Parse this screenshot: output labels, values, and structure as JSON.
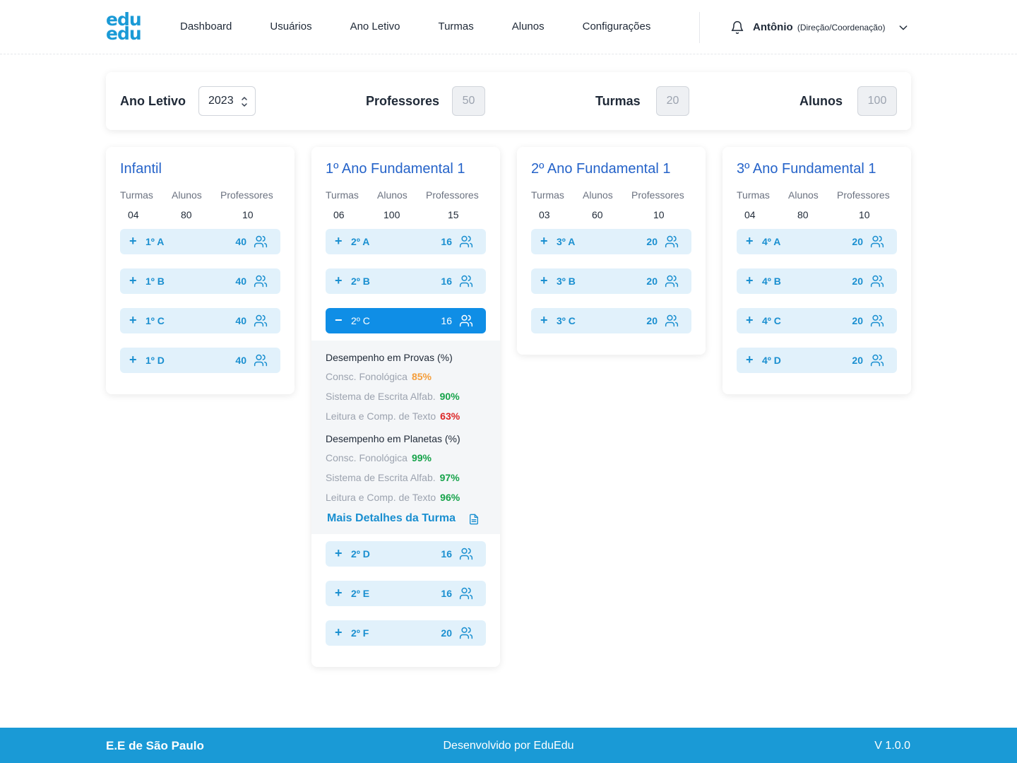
{
  "header": {
    "logo_top": "edu",
    "logo_bottom": "edu",
    "nav": [
      "Dashboard",
      "Usuários",
      "Ano Letivo",
      "Turmas",
      "Alunos",
      "Configurações"
    ],
    "user_name": "Antônio",
    "user_role": "(Direção/Coordenação)"
  },
  "summary": {
    "ano_label": "Ano Letivo",
    "ano_value": "2023",
    "professores_label": "Professores",
    "professores_value": "50",
    "turmas_label": "Turmas",
    "turmas_value": "20",
    "alunos_label": "Alunos",
    "alunos_value": "100"
  },
  "stat_labels": {
    "turmas": "Turmas",
    "alunos": "Alunos",
    "professores": "Professores"
  },
  "columns": [
    {
      "title": "Infantil",
      "turmas": "04",
      "alunos": "80",
      "professores": "10",
      "classes": [
        {
          "sign": "+",
          "name": "1º A",
          "count": "40"
        },
        {
          "sign": "+",
          "name": "1º B",
          "count": "40"
        },
        {
          "sign": "+",
          "name": "1º C",
          "count": "40"
        },
        {
          "sign": "+",
          "name": "1º D",
          "count": "40"
        }
      ]
    },
    {
      "title": "1º Ano Fundamental 1",
      "turmas": "06",
      "alunos": "100",
      "professores": "15",
      "classes": [
        {
          "sign": "+",
          "name": "2º A",
          "count": "16"
        },
        {
          "sign": "+",
          "name": "2º B",
          "count": "16"
        },
        {
          "sign": "−",
          "name": "2º C",
          "count": "16",
          "active": true
        },
        {
          "sign": "+",
          "name": "2º D",
          "count": "16"
        },
        {
          "sign": "+",
          "name": "2º E",
          "count": "16"
        },
        {
          "sign": "+",
          "name": "2º F",
          "count": "20"
        }
      ],
      "details": {
        "provas_title": "Desempenho em Provas (%)",
        "provas": [
          {
            "label": "Consc. Fonológica",
            "value": "85%",
            "color": "#f59e3b"
          },
          {
            "label": "Sistema de Escrita Alfab.",
            "value": "90%",
            "color": "#16a34a"
          },
          {
            "label": "Leitura e Comp. de Texto",
            "value": "63%",
            "color": "#dc2626"
          }
        ],
        "planetas_title": "Desempenho em Planetas (%)",
        "planetas": [
          {
            "label": "Consc. Fonológica",
            "value": "99%",
            "color": "#16a34a"
          },
          {
            "label": "Sistema de Escrita Alfab.",
            "value": "97%",
            "color": "#16a34a"
          },
          {
            "label": "Leitura e Comp. de Texto",
            "value": "96%",
            "color": "#16a34a"
          }
        ],
        "more_link": "Mais Detalhes da Turma"
      }
    },
    {
      "title": "2º Ano Fundamental 1",
      "turmas": "03",
      "alunos": "60",
      "professores": "10",
      "classes": [
        {
          "sign": "+",
          "name": "3º A",
          "count": "20"
        },
        {
          "sign": "+",
          "name": "3º B",
          "count": "20"
        },
        {
          "sign": "+",
          "name": "3º C",
          "count": "20"
        }
      ]
    },
    {
      "title": "3º Ano Fundamental 1",
      "turmas": "04",
      "alunos": "80",
      "professores": "10",
      "classes": [
        {
          "sign": "+",
          "name": "4º A",
          "count": "20"
        },
        {
          "sign": "+",
          "name": "4º B",
          "count": "20"
        },
        {
          "sign": "+",
          "name": "4º C",
          "count": "20"
        },
        {
          "sign": "+",
          "name": "4º D",
          "count": "20"
        }
      ]
    }
  ],
  "footer": {
    "left": "E.E de São Paulo",
    "mid": "Desenvolvido por EduEdu",
    "right": "V 1.0.0"
  },
  "colors": {
    "brand": "#1a9ad6",
    "active": "#0f8ee6",
    "title": "#2563c9"
  }
}
